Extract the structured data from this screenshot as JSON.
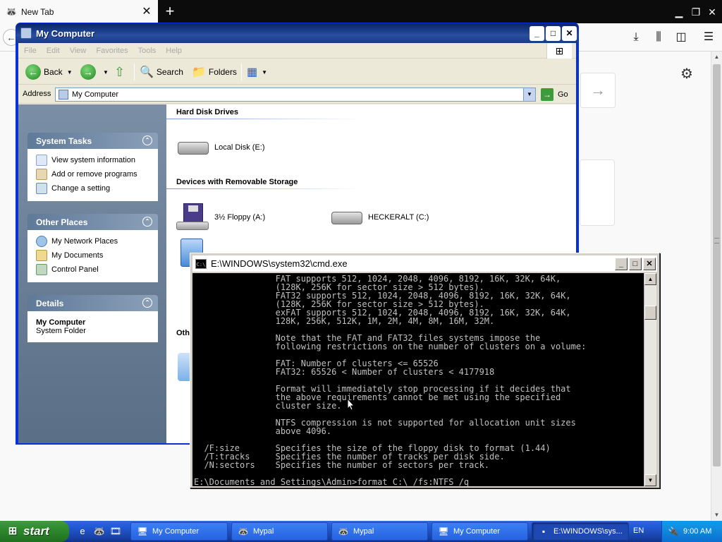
{
  "firefox": {
    "tab_title": "New Tab",
    "tab_close": "✕",
    "new_tab": "+",
    "back_icon": "arrow-left-icon",
    "forward_arrow": "→"
  },
  "explorer": {
    "title": "My Computer",
    "menu": [
      "File",
      "Edit",
      "View",
      "Favorites",
      "Tools",
      "Help"
    ],
    "toolbar": {
      "back": "Back",
      "search": "Search",
      "folders": "Folders"
    },
    "address_label": "Address",
    "address_value": "My Computer",
    "go_label": "Go",
    "panels": {
      "system_tasks": {
        "title": "System Tasks",
        "items": [
          "View system information",
          "Add or remove programs",
          "Change a setting"
        ]
      },
      "other_places": {
        "title": "Other Places",
        "items": [
          "My Network Places",
          "My Documents",
          "Control Panel"
        ]
      },
      "details": {
        "title": "Details",
        "name": "My Computer",
        "type": "System Folder"
      }
    },
    "groups": {
      "hard_disks": "Hard Disk Drives",
      "removable": "Devices with Removable Storage",
      "other": "Oth"
    },
    "drives": {
      "local_disk": "Local Disk (E:)",
      "floppy": "3½ Floppy (A:)",
      "heckeralt": "HECKERALT (C:)"
    }
  },
  "cmd": {
    "title": "E:\\WINDOWS\\system32\\cmd.exe",
    "lines": [
      "                FAT supports 512, 1024, 2048, 4096, 8192, 16K, 32K, 64K,",
      "                (128K, 256K for sector size > 512 bytes).",
      "                FAT32 supports 512, 1024, 2048, 4096, 8192, 16K, 32K, 64K,",
      "                (128K, 256K for sector size > 512 bytes).",
      "                exFAT supports 512, 1024, 2048, 4096, 8192, 16K, 32K, 64K,",
      "                128K, 256K, 512K, 1M, 2M, 4M, 8M, 16M, 32M.",
      "",
      "                Note that the FAT and FAT32 files systems impose the",
      "                following restrictions on the number of clusters on a volume:",
      "",
      "                FAT: Number of clusters <= 65526",
      "                FAT32: 65526 < Number of clusters < 4177918",
      "",
      "                Format will immediately stop processing if it decides that",
      "                the above requirements cannot be met using the specified",
      "                cluster size.",
      "",
      "                NTFS compression is not supported for allocation unit sizes",
      "                above 4096.",
      "",
      "  /F:size       Specifies the size of the floppy disk to format (1.44)",
      "  /T:tracks     Specifies the number of tracks per disk side.",
      "  /N:sectors    Specifies the number of sectors per track.",
      "",
      "E:\\Documents and Settings\\Admin>format C:\\ /fs:NTFS /q"
    ]
  },
  "taskbar": {
    "start": "start",
    "tasks": [
      {
        "label": "My Computer",
        "icon": "computer-icon"
      },
      {
        "label": "Mypal",
        "icon": "mypal-icon"
      },
      {
        "label": "Mypal",
        "icon": "mypal-icon"
      },
      {
        "label": "My Computer",
        "icon": "computer-icon"
      },
      {
        "label": "E:\\WINDOWS\\sys...",
        "icon": "cmd-icon"
      }
    ],
    "language": "EN",
    "clock": "9:00 AM"
  }
}
